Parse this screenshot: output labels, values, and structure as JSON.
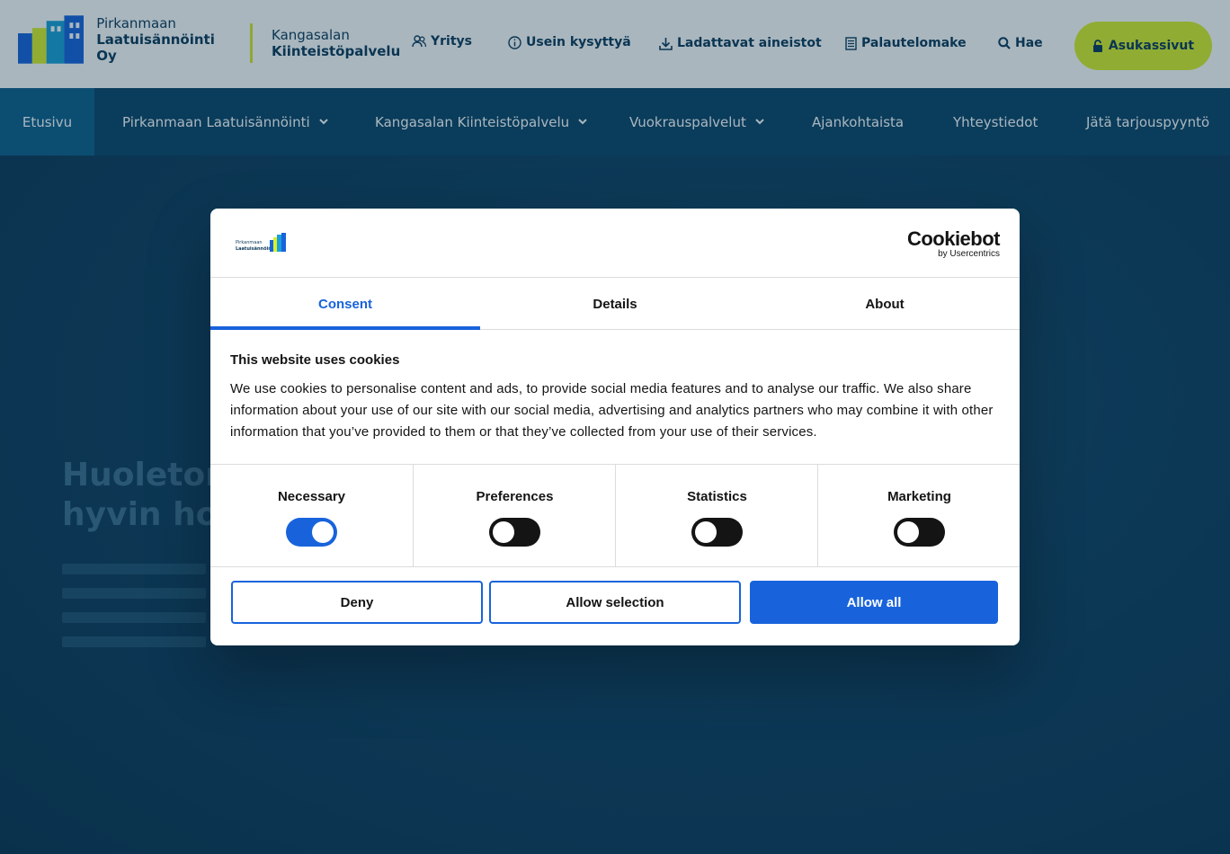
{
  "brand": {
    "logo_line1": "Pirkanmaan",
    "logo_line2": "Laatuisännöinti Oy",
    "second_line1": "Kangasalan",
    "second_line2": "Kiinteistöpalvelu",
    "accent_color": "#d9f02a",
    "primary_color": "#0c3a5a"
  },
  "toplinks": [
    {
      "label": "Yritys",
      "icon": "users-icon"
    },
    {
      "label": "Usein kysyttyä",
      "icon": "info-icon"
    },
    {
      "label": "Ladattavat aineistot",
      "icon": "download-icon"
    },
    {
      "label": "Palautelomake",
      "icon": "form-icon"
    },
    {
      "label": "Hae",
      "icon": "search-icon"
    }
  ],
  "resident_button": {
    "label": "Asukassivut",
    "icon": "lock-icon"
  },
  "nav": [
    {
      "label": "Etusivu",
      "active": true,
      "dropdown": false
    },
    {
      "label": "Pirkanmaan Laatuisännöinti",
      "active": false,
      "dropdown": true
    },
    {
      "label": "Kangasalan Kiinteistöpalvelu",
      "active": false,
      "dropdown": true
    },
    {
      "label": "Vuokrauspalvelut",
      "active": false,
      "dropdown": true
    },
    {
      "label": "Ajankohtaista",
      "active": false,
      "dropdown": false
    },
    {
      "label": "Yhteystiedot",
      "active": false,
      "dropdown": false
    },
    {
      "label": "Jätä tarjouspyyntö",
      "active": false,
      "dropdown": false
    }
  ],
  "hero": {
    "title_line1": "Huoleton",
    "title_line2": "hyvin hoid"
  },
  "cookie_dialog": {
    "provider_line1": "Cookiebot",
    "provider_line2": "by Usercentrics",
    "tabs": [
      "Consent",
      "Details",
      "About"
    ],
    "active_tab": "Consent",
    "title": "This website uses cookies",
    "body": "We use cookies to personalise content and ads, to provide social media features and to analyse our traffic. We also share information about your use of our site with our social media, advertising and analytics partners who may combine it with other information that you’ve provided to them or that they’ve collected from your use of their services.",
    "categories": [
      {
        "label": "Necessary",
        "enabled": true
      },
      {
        "label": "Preferences",
        "enabled": false
      },
      {
        "label": "Statistics",
        "enabled": false
      },
      {
        "label": "Marketing",
        "enabled": false
      }
    ],
    "buttons": {
      "deny": "Deny",
      "allow_selection": "Allow selection",
      "allow_all": "Allow all"
    },
    "accent_color": "#1863dc"
  }
}
